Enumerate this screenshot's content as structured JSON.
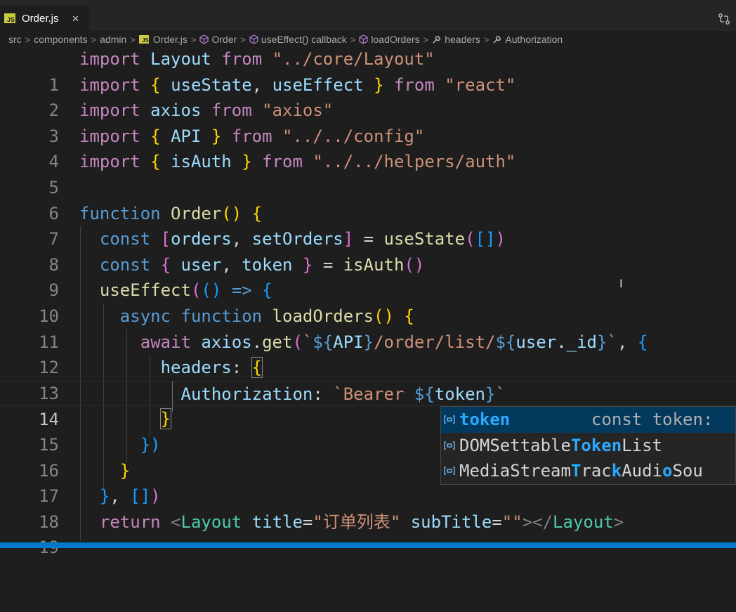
{
  "tab": {
    "badge": "JS",
    "label": "Order.js",
    "close": "×"
  },
  "breadcrumb": {
    "items": [
      "src",
      "components",
      "admin",
      "Order.js",
      "Order",
      "useEffect() callback",
      "loadOrders",
      "headers",
      "Authorization"
    ],
    "separator": ">"
  },
  "editor": {
    "active_line": 14,
    "lines": [
      {
        "n": "1"
      },
      {
        "n": "2"
      },
      {
        "n": "3"
      },
      {
        "n": "4"
      },
      {
        "n": "5"
      },
      {
        "n": "6"
      },
      {
        "n": "7"
      },
      {
        "n": "8"
      },
      {
        "n": "9"
      },
      {
        "n": "10"
      },
      {
        "n": "11"
      },
      {
        "n": "12"
      },
      {
        "n": "13"
      },
      {
        "n": "14"
      },
      {
        "n": "15"
      },
      {
        "n": "16"
      },
      {
        "n": "17"
      },
      {
        "n": "18"
      },
      {
        "n": "19"
      }
    ]
  },
  "code": {
    "l1": [
      "import",
      "Layout",
      "from",
      "\"../core/Layout\""
    ],
    "l2": [
      "import",
      "{",
      "useState",
      ",",
      "useEffect",
      "}",
      "from",
      "\"react\""
    ],
    "l3": [
      "import",
      "axios",
      "from",
      "\"axios\""
    ],
    "l4": [
      "import",
      "{",
      "API",
      "}",
      "from",
      "\"../../config\""
    ],
    "l5": [
      "import",
      "{",
      "isAuth",
      "}",
      "from",
      "\"../../helpers/auth\""
    ],
    "l7": [
      "function",
      "Order",
      "()",
      "{"
    ],
    "l8": [
      "const",
      "[",
      "orders",
      ",",
      "setOrders",
      "]",
      "=",
      "useState",
      "(",
      "[]",
      ")"
    ],
    "l9": [
      "const",
      "{",
      "user",
      ",",
      "token",
      "}",
      "=",
      "isAuth",
      "()"
    ],
    "l10": [
      "useEffect",
      "(",
      "()",
      "=>",
      "{"
    ],
    "l11": [
      "async",
      "function",
      "loadOrders",
      "()",
      "{"
    ],
    "l12": [
      "await",
      "axios",
      ".",
      "get",
      "(",
      "`",
      "${",
      "API",
      "}",
      "/order/list/",
      "${",
      "user",
      ".",
      "_id",
      "}",
      "`",
      ",",
      "{"
    ],
    "l13": [
      "headers",
      ":",
      "{"
    ],
    "l14": [
      "Authorization",
      ":",
      "`Bearer ",
      "${",
      "token",
      "}",
      "`"
    ],
    "l15": [
      "}"
    ],
    "l16": [
      "})"
    ],
    "l17": [
      "}"
    ],
    "l18": [
      "}",
      ",",
      "[]",
      ")"
    ],
    "l19": [
      "return",
      "<",
      "Layout",
      "title",
      "=",
      "\"订单列表\"",
      "subTitle",
      "=",
      "\"\"",
      "></",
      "Layout",
      ">"
    ]
  },
  "suggest": {
    "items": [
      {
        "pre": "",
        "hl": "token",
        "post": "",
        "detail": "const token:"
      },
      {
        "pre": "DOMSettable",
        "hl": "Token",
        "post": "List",
        "detail": ""
      },
      {
        "pre": "MediaStream",
        "hl": "T",
        "mid": "rac",
        "hl2": "k",
        "mid2": "Audi",
        "hl3": "o",
        "post": "Sou",
        "detail": ""
      }
    ]
  },
  "colors": {
    "accent": "#007acc",
    "background": "#1e1e1e",
    "selection": "#04395e"
  }
}
